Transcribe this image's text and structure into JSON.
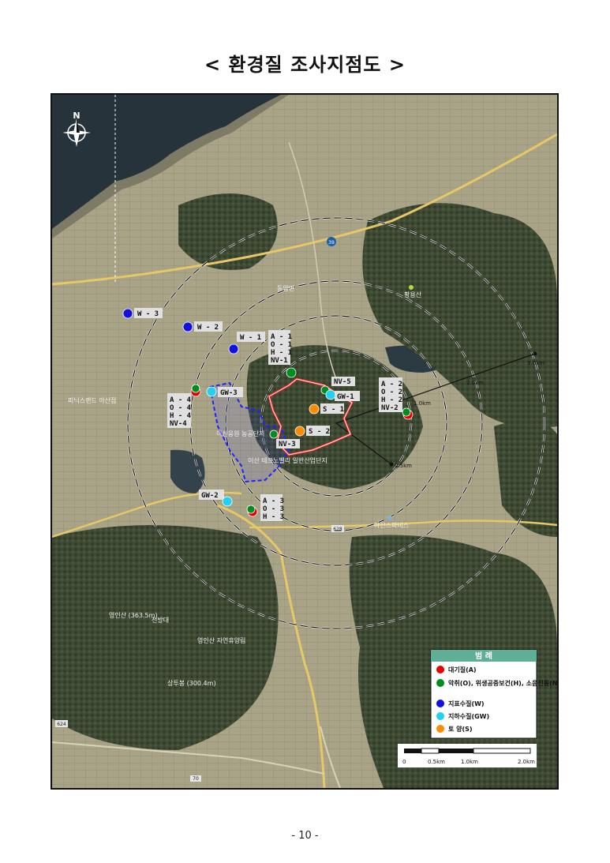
{
  "title": "< 환경질 조사지점도 >",
  "page_number": "- 10 -",
  "north_label": "N",
  "rings": [
    "0.5km",
    "1.0km",
    "2.0km",
    "3.0km"
  ],
  "colors": {
    "air": "#e60000",
    "odor": "#008c1e",
    "surface_water": "#1010e0",
    "groundwater": "#22d0f0",
    "soil": "#ff8c00",
    "boundary": "#ff2020",
    "industrial": "#2222ff",
    "legend_header": "#5fae96"
  },
  "points": [
    {
      "id": "w3",
      "type": "surface_water",
      "label": "W - 3"
    },
    {
      "id": "w2",
      "type": "surface_water",
      "label": "W - 2"
    },
    {
      "id": "w1",
      "type": "surface_water",
      "label": "W - 1"
    },
    {
      "id": "a1",
      "type": "odor",
      "label": "A - 1 O - 1 H - 1 NV-1"
    },
    {
      "id": "a4",
      "type": "odor",
      "label": "A - 4 O - 4 H - 4 NV-4"
    },
    {
      "id": "gw3",
      "type": "groundwater",
      "label": "GW-3"
    },
    {
      "id": "nv5",
      "type": "odor",
      "label": "NV-5"
    },
    {
      "id": "gw1",
      "type": "groundwater",
      "label": "GW-1"
    },
    {
      "id": "s1",
      "type": "soil",
      "label": "S - 1"
    },
    {
      "id": "s2",
      "type": "soil",
      "label": "S - 2"
    },
    {
      "id": "nv3",
      "type": "odor",
      "label": "NV-3"
    },
    {
      "id": "a2",
      "type": "odor",
      "label": "A - 2 O - 2 H - 2 NV-2"
    },
    {
      "id": "gw2",
      "type": "groundwater",
      "label": "GW-2"
    },
    {
      "id": "a3",
      "type": "odor",
      "label": "A - 3 O - 3 H - 3"
    }
  ],
  "place_names": {
    "hwangyong": "황용산",
    "dongam": "동암면",
    "iran_park": "이산웅원 농공단지",
    "industrial_zone": "이산 테크노밸리 일반산업단지",
    "service": "아산스파비스",
    "yeongin": "영인산 (363.5m)",
    "cheonbang": "천방대",
    "recreation": "영인산 자연휴양림",
    "sanggyu": "상투봉 (300.4m)",
    "pyeongtaek": "평택항",
    "seoul_area": "피닉스랜드 아산점"
  },
  "legend": {
    "title": "범  례",
    "items": [
      {
        "type": "air",
        "label": "대기질(A)"
      },
      {
        "type": "odor",
        "label": "악취(O), 위생공중보건(H), 소음진동(NV)"
      },
      {
        "type": "surface_water",
        "label": "지표수질(W)"
      },
      {
        "type": "groundwater",
        "label": "지하수질(GW)"
      },
      {
        "type": "soil",
        "label": "토   양(S)"
      }
    ]
  },
  "scale_bar": {
    "ticks": [
      "0",
      "0.5km",
      "1.0km",
      "2.0km"
    ]
  },
  "roads": [
    "39",
    "628",
    "70",
    "624"
  ]
}
